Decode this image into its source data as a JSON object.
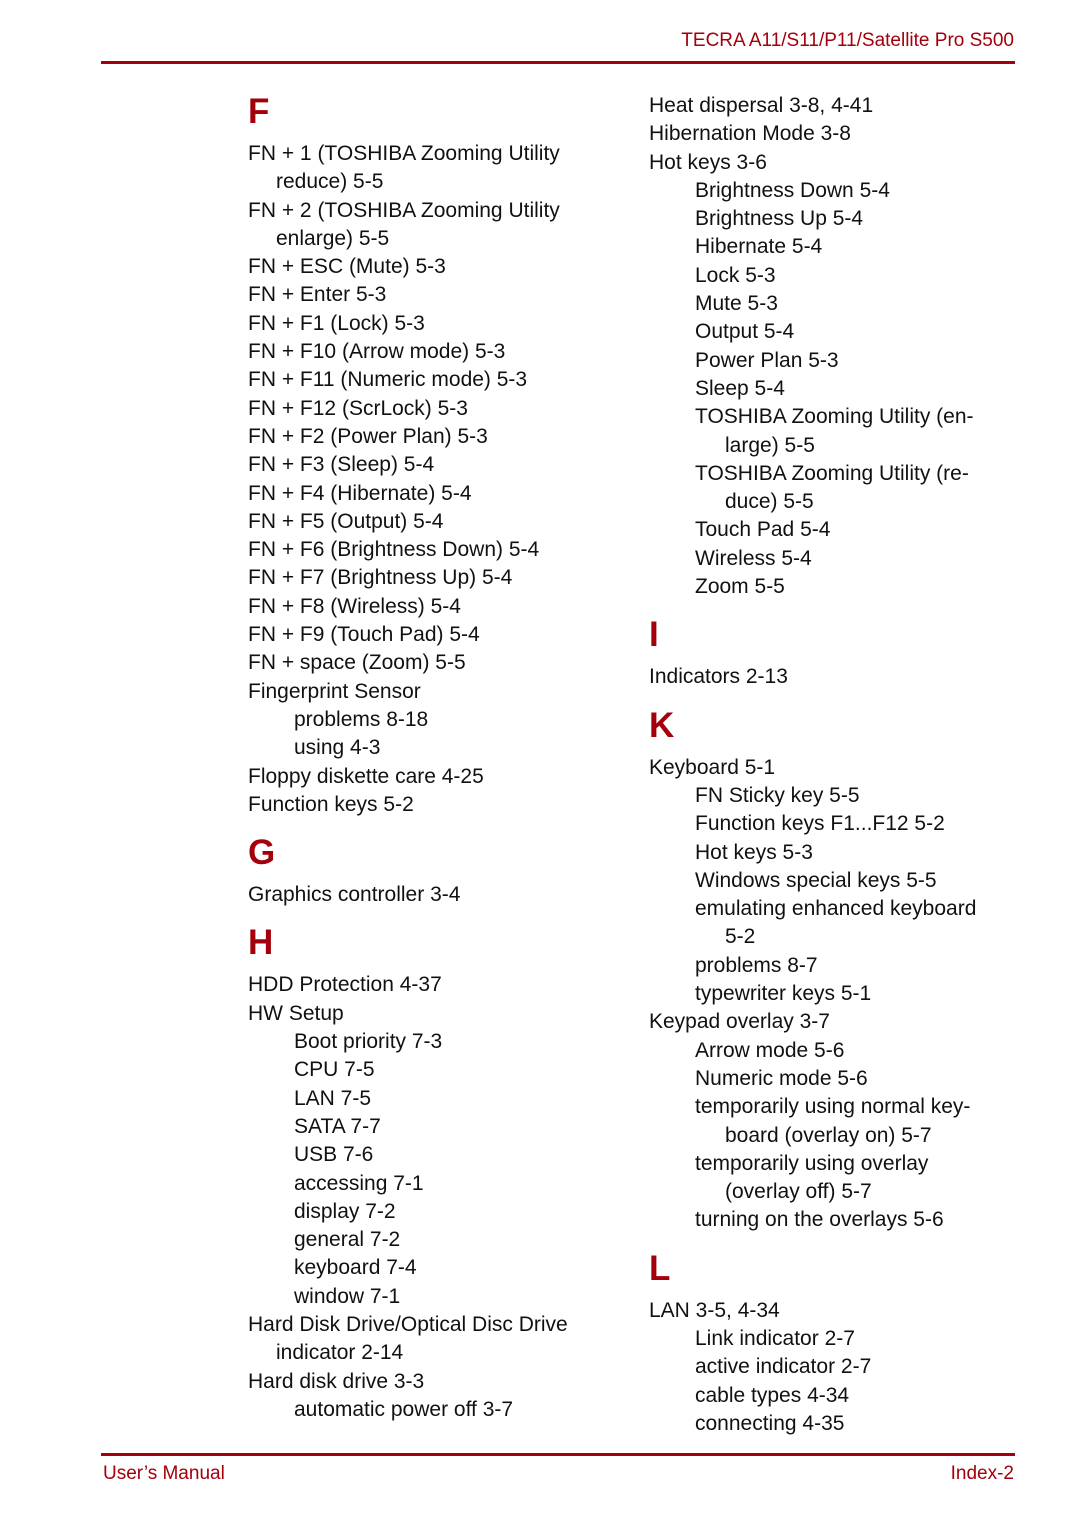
{
  "header": {
    "title": "TECRA A11/S11/P11/Satellite Pro S500"
  },
  "footer": {
    "left": "User’s Manual",
    "right": "Index-2"
  },
  "left_column": [
    {
      "letter": "F",
      "lines": [
        {
          "text": "FN + 1 (TOSHIBA Zooming Utility",
          "level": 0
        },
        {
          "text": "reduce) 5-5",
          "level": 0,
          "cont": true
        },
        {
          "text": "FN + 2 (TOSHIBA Zooming Utility",
          "level": 0
        },
        {
          "text": "enlarge) 5-5",
          "level": 0,
          "cont": true
        },
        {
          "text": "FN + ESC (Mute) 5-3",
          "level": 0
        },
        {
          "text": "FN + Enter 5-3",
          "level": 0
        },
        {
          "text": "FN + F1 (Lock) 5-3",
          "level": 0
        },
        {
          "text": "FN + F10 (Arrow mode) 5-3",
          "level": 0
        },
        {
          "text": "FN + F11 (Numeric mode) 5-3",
          "level": 0
        },
        {
          "text": "FN + F12 (ScrLock) 5-3",
          "level": 0
        },
        {
          "text": "FN + F2 (Power Plan) 5-3",
          "level": 0
        },
        {
          "text": "FN + F3 (Sleep) 5-4",
          "level": 0
        },
        {
          "text": "FN + F4 (Hibernate) 5-4",
          "level": 0
        },
        {
          "text": "FN + F5 (Output) 5-4",
          "level": 0
        },
        {
          "text": "FN + F6 (Brightness Down) 5-4",
          "level": 0
        },
        {
          "text": "FN + F7 (Brightness Up) 5-4",
          "level": 0
        },
        {
          "text": "FN + F8 (Wireless) 5-4",
          "level": 0
        },
        {
          "text": "FN + F9 (Touch Pad) 5-4",
          "level": 0
        },
        {
          "text": "FN + space (Zoom) 5-5",
          "level": 0
        },
        {
          "text": "Fingerprint Sensor",
          "level": 0
        },
        {
          "text": "problems 8-18",
          "level": 1
        },
        {
          "text": "using 4-3",
          "level": 1
        },
        {
          "text": "Floppy diskette care 4-25",
          "level": 0
        },
        {
          "text": "Function keys 5-2",
          "level": 0
        }
      ]
    },
    {
      "letter": "G",
      "lines": [
        {
          "text": "Graphics controller 3-4",
          "level": 0
        }
      ]
    },
    {
      "letter": "H",
      "lines": [
        {
          "text": "HDD Protection 4-37",
          "level": 0
        },
        {
          "text": "HW Setup",
          "level": 0
        },
        {
          "text": "Boot priority 7-3",
          "level": 1
        },
        {
          "text": "CPU 7-5",
          "level": 1
        },
        {
          "text": "LAN 7-5",
          "level": 1
        },
        {
          "text": "SATA 7-7",
          "level": 1
        },
        {
          "text": "USB 7-6",
          "level": 1
        },
        {
          "text": "accessing 7-1",
          "level": 1
        },
        {
          "text": "display 7-2",
          "level": 1
        },
        {
          "text": "general 7-2",
          "level": 1
        },
        {
          "text": "keyboard 7-4",
          "level": 1
        },
        {
          "text": "window 7-1",
          "level": 1
        },
        {
          "text": "Hard Disk Drive/Optical Disc Drive",
          "level": 0
        },
        {
          "text": "indicator 2-14",
          "level": 0,
          "cont": true
        },
        {
          "text": "Hard disk drive 3-3",
          "level": 0
        },
        {
          "text": "automatic power off 3-7",
          "level": 1
        }
      ]
    }
  ],
  "right_column": [
    {
      "letter": "",
      "lines": [
        {
          "text": "Heat dispersal 3-8, 4-41",
          "level": 0
        },
        {
          "text": "Hibernation Mode 3-8",
          "level": 0
        },
        {
          "text": "Hot keys 3-6",
          "level": 0
        },
        {
          "text": "Brightness Down 5-4",
          "level": 1
        },
        {
          "text": "Brightness Up 5-4",
          "level": 1
        },
        {
          "text": "Hibernate 5-4",
          "level": 1
        },
        {
          "text": "Lock 5-3",
          "level": 1
        },
        {
          "text": "Mute 5-3",
          "level": 1
        },
        {
          "text": "Output 5-4",
          "level": 1
        },
        {
          "text": "Power Plan 5-3",
          "level": 1
        },
        {
          "text": "Sleep 5-4",
          "level": 1
        },
        {
          "text": "TOSHIBA Zooming Utility (en-",
          "level": 1
        },
        {
          "text": "large) 5-5",
          "level": 1,
          "cont": true
        },
        {
          "text": "TOSHIBA Zooming Utility (re-",
          "level": 1
        },
        {
          "text": "duce) 5-5",
          "level": 1,
          "cont": true
        },
        {
          "text": "Touch Pad 5-4",
          "level": 1
        },
        {
          "text": "Wireless 5-4",
          "level": 1
        },
        {
          "text": "Zoom 5-5",
          "level": 1
        }
      ]
    },
    {
      "letter": "I",
      "lines": [
        {
          "text": "Indicators 2-13",
          "level": 0
        }
      ]
    },
    {
      "letter": "K",
      "lines": [
        {
          "text": "Keyboard 5-1",
          "level": 0
        },
        {
          "text": "FN Sticky key 5-5",
          "level": 1
        },
        {
          "text": "Function keys F1...F12 5-2",
          "level": 1
        },
        {
          "text": "Hot keys 5-3",
          "level": 1
        },
        {
          "text": "Windows special keys 5-5",
          "level": 1
        },
        {
          "text": "emulating enhanced keyboard",
          "level": 1
        },
        {
          "text": "5-2",
          "level": 1,
          "cont": true
        },
        {
          "text": "problems 8-7",
          "level": 1
        },
        {
          "text": "typewriter keys 5-1",
          "level": 1
        },
        {
          "text": "Keypad overlay 3-7",
          "level": 0
        },
        {
          "text": "Arrow mode 5-6",
          "level": 1
        },
        {
          "text": "Numeric mode 5-6",
          "level": 1
        },
        {
          "text": "temporarily using normal key-",
          "level": 1
        },
        {
          "text": "board (overlay on) 5-7",
          "level": 1,
          "cont": true
        },
        {
          "text": "temporarily using overlay",
          "level": 1
        },
        {
          "text": "(overlay off) 5-7",
          "level": 1,
          "cont": true
        },
        {
          "text": "turning on the overlays 5-6",
          "level": 1
        }
      ]
    },
    {
      "letter": "L",
      "lines": [
        {
          "text": "LAN 3-5, 4-34",
          "level": 0
        },
        {
          "text": "Link indicator 2-7",
          "level": 1
        },
        {
          "text": "active indicator 2-7",
          "level": 1
        },
        {
          "text": "cable types 4-34",
          "level": 1
        },
        {
          "text": "connecting 4-35",
          "level": 1
        }
      ]
    }
  ]
}
